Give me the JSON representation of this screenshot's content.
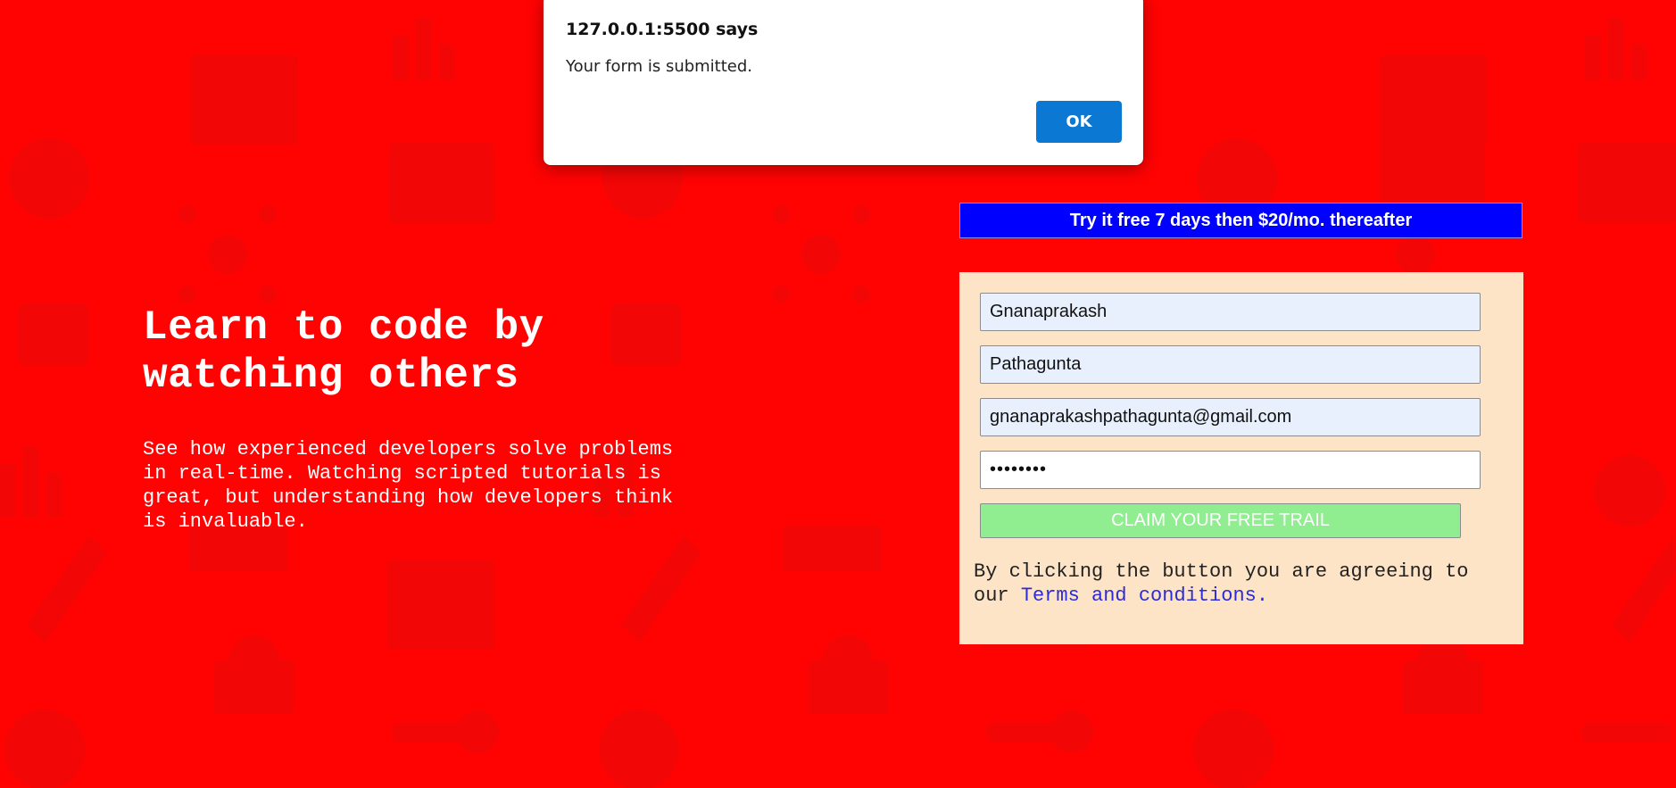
{
  "colors": {
    "page_background": "#ff0303",
    "banner_background": "#0000ff",
    "form_background": "#fee4c6",
    "claim_button": "#90ee90",
    "dialog_ok": "#0b78d4",
    "link": "#2b2bd8"
  },
  "dialog": {
    "origin": "127.0.0.1:5500 says",
    "message": "Your form is submitted.",
    "ok_label": "OK"
  },
  "hero": {
    "title": "Learn to code by watching others",
    "description": "See how experienced developers solve problems in real-time. Watching scripted tutorials is great, but understanding how developers think is invaluable."
  },
  "banner": {
    "text": "Try it free 7 days then $20/mo. thereafter"
  },
  "form": {
    "first_name": "Gnanaprakash",
    "last_name": "Pathagunta",
    "email": "gnanaprakashpathagunta@gmail.com",
    "password": "••••••••",
    "submit_label": "CLAIM YOUR FREE TRAIL",
    "terms_prefix": "By clicking the button you are agreeing to our ",
    "terms_link": "Terms and conditions."
  },
  "background_icons": [
    "browser-window-icon",
    "rocket-icon",
    "gear-icon",
    "network-icon",
    "thumbs-up-icon",
    "bar-chart-icon",
    "toolbox-icon",
    "headset-icon",
    "globe-icon",
    "key-icon",
    "shopping-cart-icon",
    "speech-bubble-icon"
  ]
}
